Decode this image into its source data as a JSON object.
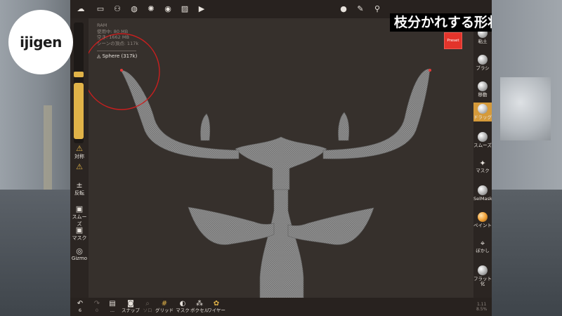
{
  "logo_text": "ijigen",
  "caption": "枝分かれする形状を作る時にも便利",
  "stats": {
    "ram_label": "RAM",
    "used_label": "使用中: 80 MB",
    "free_label": "空き: 1662 MB",
    "vertices_label": "シーンの頂点: 117k"
  },
  "scene_item": "Sphere (317k)",
  "preset_label": "Preset",
  "left_tools": [
    {
      "icon": "warning-triangle-icon",
      "glyph": "⚠",
      "label": "対称"
    },
    {
      "icon": "pose-icon",
      "glyph": "⚠",
      "label": ""
    },
    {
      "icon": "plus-minus-icon",
      "glyph": "±",
      "label": "反転"
    },
    {
      "icon": "smooth-icon",
      "glyph": "▣",
      "label": "スムーズ"
    },
    {
      "icon": "mask-icon",
      "glyph": "▣",
      "label": "マスク"
    },
    {
      "icon": "gizmo-icon",
      "glyph": "◎",
      "label": "Gizmo"
    }
  ],
  "right_tools": [
    {
      "name": "clay",
      "label": "粘土",
      "active": false,
      "style": "ball"
    },
    {
      "name": "brush",
      "label": "ブラシ",
      "active": false,
      "style": "ball"
    },
    {
      "name": "move",
      "label": "移動",
      "active": false,
      "style": "ball"
    },
    {
      "name": "drag",
      "label": "ドラッグ",
      "active": true,
      "style": "ball"
    },
    {
      "name": "smooth",
      "label": "スムーズ",
      "active": false,
      "style": "ball"
    },
    {
      "name": "mask",
      "label": "マスク",
      "active": false,
      "style": "glyph",
      "glyph": "✦"
    },
    {
      "name": "selmask",
      "label": "SelMask",
      "active": false,
      "style": "ball"
    },
    {
      "name": "paint",
      "label": "ペイント",
      "active": false,
      "style": "orange"
    },
    {
      "name": "blur",
      "label": "ぼかし",
      "active": false,
      "style": "glyph",
      "glyph": "⌖"
    },
    {
      "name": "flatten",
      "label": "フラット化",
      "active": false,
      "style": "ball"
    }
  ],
  "bottom_tools": [
    {
      "name": "undo",
      "icon": "undo-icon",
      "glyph": "↶",
      "label": "6",
      "dim": false,
      "accent": false
    },
    {
      "name": "redo",
      "icon": "redo-icon",
      "glyph": "↷",
      "label": "0",
      "dim": true,
      "accent": false
    },
    {
      "name": "layers",
      "icon": "layers-icon",
      "glyph": "▤",
      "label": "...",
      "dim": false,
      "accent": false
    },
    {
      "name": "snap",
      "icon": "camera-icon",
      "glyph": "◙",
      "label": "スナップ",
      "dim": false,
      "accent": false
    },
    {
      "name": "solo",
      "icon": "search-icon",
      "glyph": "⌕",
      "label": "ソロ",
      "dim": true,
      "accent": false
    },
    {
      "name": "grid",
      "icon": "grid-icon",
      "glyph": "#",
      "label": "グリッド",
      "dim": false,
      "accent": true
    },
    {
      "name": "mask",
      "icon": "eye-slash-icon",
      "glyph": "◐",
      "label": "マスク",
      "dim": false,
      "accent": false
    },
    {
      "name": "voxel",
      "icon": "voxel-icon",
      "glyph": "⁂",
      "label": "ボクセル",
      "dim": false,
      "accent": false
    },
    {
      "name": "wire",
      "icon": "wireframe-icon",
      "glyph": "✿",
      "label": "ワイヤー",
      "dim": false,
      "accent": true
    }
  ],
  "corner_info": {
    "line1": "1.11",
    "line2": "8.5%"
  },
  "colors": {
    "accent": "#e1b348",
    "preset_red": "#e3342b",
    "viewport_bg": "#36302c",
    "mesh": "#8f8f8f"
  }
}
